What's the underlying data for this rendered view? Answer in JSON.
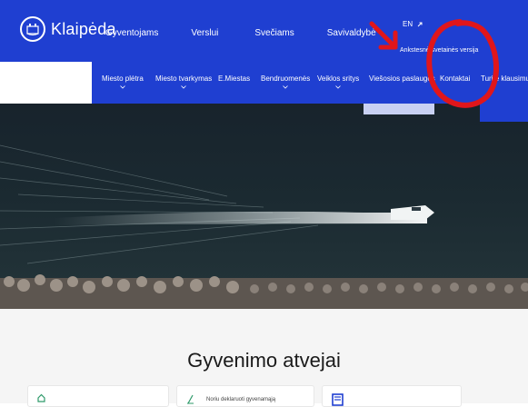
{
  "header": {
    "brand": "Klaipėda",
    "nav": [
      "Gyventojams",
      "Verslui",
      "Svečiams",
      "Savivaldybė"
    ],
    "lang": "EN",
    "old_version": "Ankstesnė svetainės versija"
  },
  "subnav": [
    "Miesto plėtra",
    "Miesto tvarkymas",
    "E.Miestas",
    "Bendruomenės",
    "Veiklos sritys",
    "Viešosios paslaugos",
    "Kontaktai",
    "Turite klausimų?"
  ],
  "section": {
    "title": "Gyvenimo atvejai",
    "cards": [
      "",
      "Noriu deklaruoti gyvenamąją",
      ""
    ]
  },
  "colors": {
    "brand_blue": "#1f3fd1",
    "annotation_red": "#e0161b"
  },
  "icons": [
    "klaipeda-logo-icon",
    "external-link-icon",
    "chevron-down-icon",
    "house-icon",
    "pen-icon",
    "document-icon"
  ]
}
